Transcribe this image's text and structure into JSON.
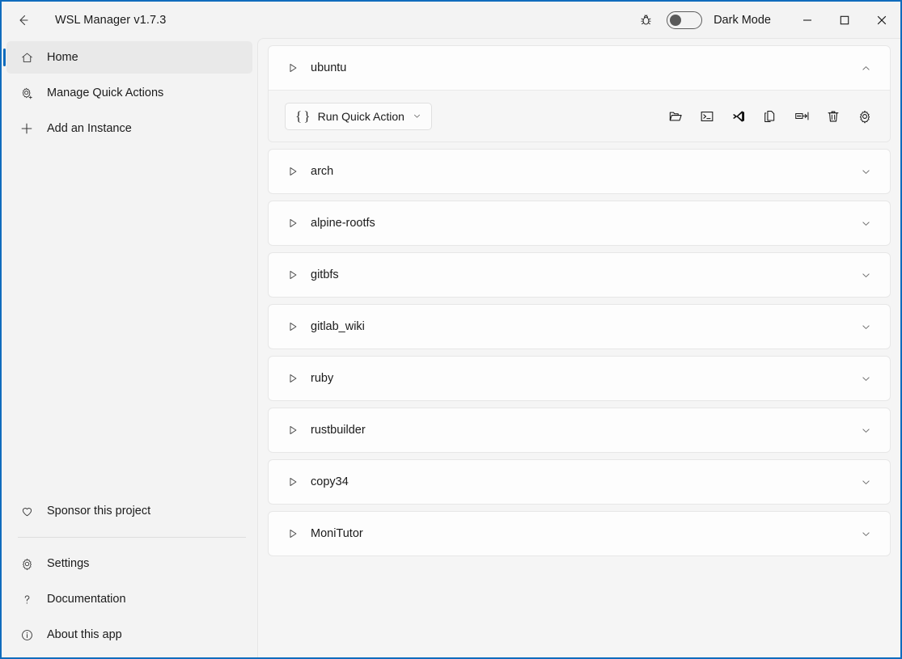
{
  "window": {
    "title": "WSL Manager v1.7.3",
    "accent_color": "#0f6cbd",
    "back_icon": "arrow-left-icon",
    "debug_icon": "bug-icon",
    "dark_mode_label": "Dark Mode",
    "dark_mode_enabled": false,
    "controls": {
      "minimize": "minimize-icon",
      "maximize": "maximize-icon",
      "close": "close-icon"
    }
  },
  "sidebar": {
    "top_items": [
      {
        "label": "Home",
        "icon": "home-icon",
        "selected": true
      },
      {
        "label": "Manage Quick Actions",
        "icon": "gear-plus-icon",
        "selected": false
      },
      {
        "label": "Add an Instance",
        "icon": "plus-icon",
        "selected": false
      }
    ],
    "sponsor_item": {
      "label": "Sponsor this project",
      "icon": "heart-icon"
    },
    "bottom_items": [
      {
        "label": "Settings",
        "icon": "gear-icon"
      },
      {
        "label": "Documentation",
        "icon": "question-mark-icon"
      },
      {
        "label": "About this app",
        "icon": "info-circle-icon"
      }
    ]
  },
  "main": {
    "quick_action": {
      "label": "Run Quick Action",
      "braces": "{ }",
      "chevron": "chevron-down-icon"
    },
    "action_icons": [
      {
        "name": "open-folder-icon",
        "title": "Open folder"
      },
      {
        "name": "terminal-icon",
        "title": "Open terminal"
      },
      {
        "name": "vscode-icon",
        "title": "Open in VS Code"
      },
      {
        "name": "copy-icon",
        "title": "Duplicate"
      },
      {
        "name": "rename-icon",
        "title": "Rename"
      },
      {
        "name": "trash-icon",
        "title": "Delete"
      },
      {
        "name": "gear-icon",
        "title": "Settings"
      }
    ],
    "instances": [
      {
        "name": "ubuntu",
        "expanded": true
      },
      {
        "name": "arch",
        "expanded": false
      },
      {
        "name": "alpine-rootfs",
        "expanded": false
      },
      {
        "name": "gitbfs",
        "expanded": false
      },
      {
        "name": "gitlab_wiki",
        "expanded": false
      },
      {
        "name": "ruby",
        "expanded": false
      },
      {
        "name": "rustbuilder",
        "expanded": false
      },
      {
        "name": "copy34",
        "expanded": false
      },
      {
        "name": "MoniTutor",
        "expanded": false
      }
    ]
  }
}
